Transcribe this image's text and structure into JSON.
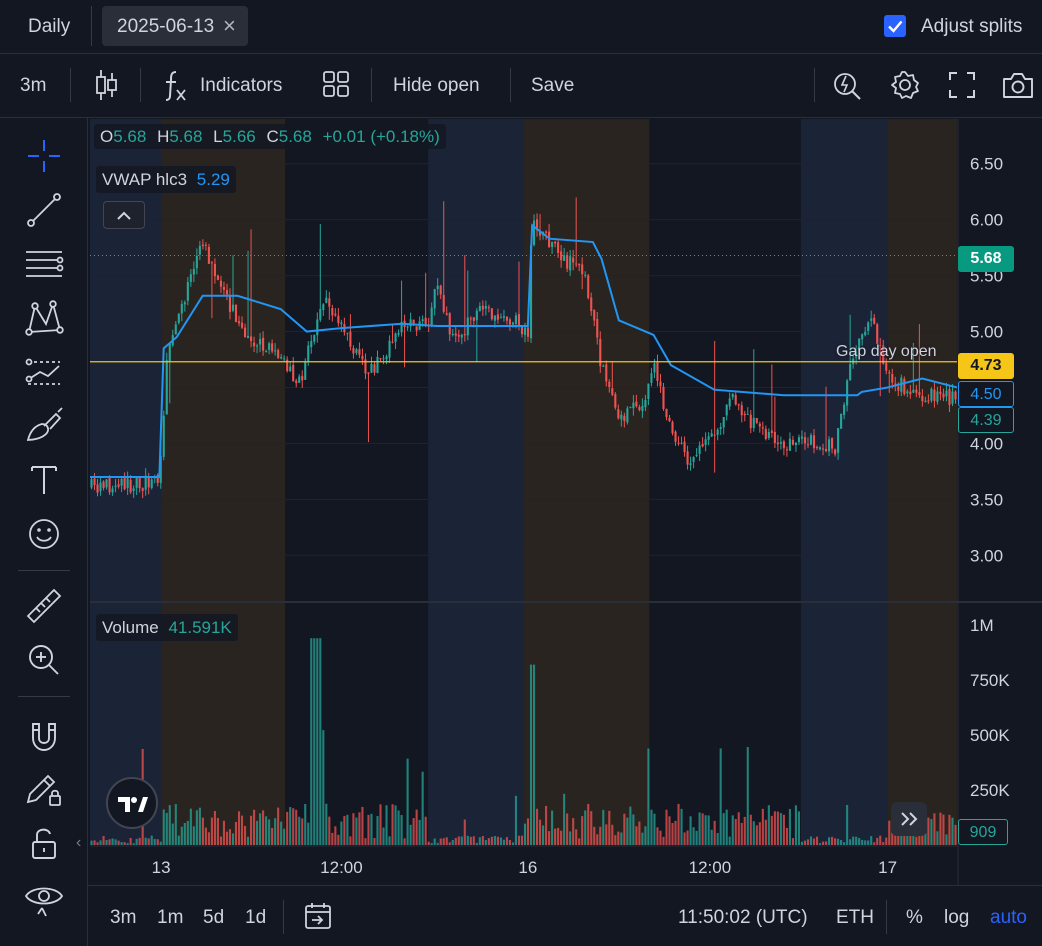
{
  "topbar": {
    "interval_label": "Daily",
    "date_value": "2025-06-13",
    "close_glyph": "×",
    "adjust_splits_label": "Adjust splits",
    "adjust_splits_checked": true
  },
  "toolbar": {
    "timeframe": "3m",
    "indicators_label": "Indicators",
    "hide_open_label": "Hide open",
    "save_label": "Save",
    "icons": [
      "candles-icon",
      "fx-icon",
      "layout-grid-icon",
      "alert-search-icon",
      "gear-icon",
      "fullscreen-icon",
      "camera-icon"
    ]
  },
  "left_tools": [
    "crosshair-icon",
    "trend-line-icon",
    "fib-lines-icon",
    "pattern-icon",
    "forecast-icon",
    "brush-icon",
    "text-icon",
    "emoji-icon",
    "ruler-icon",
    "zoom-in-icon",
    "magnet-icon",
    "pencil-lock-icon",
    "unlock-icon",
    "eye-icon"
  ],
  "legend": {
    "o_label": "O",
    "o_value": "5.68",
    "h_label": "H",
    "h_value": "5.68",
    "l_label": "L",
    "l_value": "5.66",
    "c_label": "C",
    "c_value": "5.68",
    "change": "+0.01 (+0.18%)",
    "vwap_label": "VWAP hlc3",
    "vwap_value": "5.29",
    "volume_label": "Volume",
    "volume_value": "41.591K"
  },
  "annotation": {
    "gap_label": "Gap day open"
  },
  "price_tags": {
    "last": "5.68",
    "gap": "4.73",
    "vwap": "4.50",
    "prev": "4.39",
    "volume": "909"
  },
  "colors": {
    "up": "#26a69a",
    "down": "#ef5350",
    "vwap": "#2196f3",
    "gap_line": "#f5c518",
    "premarket_bg": "#1b2336",
    "afterhours_bg": "#2a2420",
    "accent": "#2962ff"
  },
  "bottombar": {
    "tf_3m": "3m",
    "tf_1m": "1m",
    "tf_5d": "5d",
    "tf_1d": "1d",
    "time": "11:50:02 (UTC)",
    "session": "ETH",
    "pct": "%",
    "log": "log",
    "auto": "auto"
  },
  "chart_data": {
    "type": "candlestick",
    "title": "",
    "price_axis": {
      "ticks": [
        "6.50",
        "6.00",
        "5.50",
        "5.00",
        "4.50",
        "4.00",
        "3.50",
        "3.00"
      ],
      "ylim": [
        2.6,
        6.9
      ]
    },
    "volume_axis": {
      "ticks": [
        "1M",
        "750K",
        "500K",
        "250K"
      ],
      "ylim": [
        0,
        1050000
      ]
    },
    "x_ticks": [
      "13",
      "12:00",
      "16",
      "12:00",
      "17"
    ],
    "vwap_series": [
      {
        "t": 0.0,
        "v": 3.7
      },
      {
        "t": 0.08,
        "v": 3.7
      },
      {
        "t": 0.085,
        "v": 4.85
      },
      {
        "t": 0.1,
        "v": 4.95
      },
      {
        "t": 0.13,
        "v": 5.32
      },
      {
        "t": 0.17,
        "v": 5.32
      },
      {
        "t": 0.22,
        "v": 5.2
      },
      {
        "t": 0.25,
        "v": 5.0
      },
      {
        "t": 0.29,
        "v": 5.03
      },
      {
        "t": 0.36,
        "v": 5.07
      },
      {
        "t": 0.4,
        "v": 5.05
      },
      {
        "t": 0.505,
        "v": 5.05
      },
      {
        "t": 0.51,
        "v": 5.95
      },
      {
        "t": 0.53,
        "v": 5.83
      },
      {
        "t": 0.58,
        "v": 5.8
      },
      {
        "t": 0.59,
        "v": 5.65
      },
      {
        "t": 0.61,
        "v": 5.1
      },
      {
        "t": 0.65,
        "v": 4.97
      },
      {
        "t": 0.67,
        "v": 4.7
      },
      {
        "t": 0.72,
        "v": 4.48
      },
      {
        "t": 0.8,
        "v": 4.43
      },
      {
        "t": 0.885,
        "v": 4.43
      },
      {
        "t": 0.89,
        "v": 4.46
      },
      {
        "t": 0.92,
        "v": 4.5
      },
      {
        "t": 0.96,
        "v": 4.58
      },
      {
        "t": 1.0,
        "v": 4.5
      }
    ],
    "price_path": [
      {
        "t": 0.0,
        "v": 3.62
      },
      {
        "t": 0.04,
        "v": 3.63
      },
      {
        "t": 0.08,
        "v": 3.65
      },
      {
        "t": 0.09,
        "v": 4.9
      },
      {
        "t": 0.1,
        "v": 5.1
      },
      {
        "t": 0.13,
        "v": 5.8
      },
      {
        "t": 0.15,
        "v": 5.4
      },
      {
        "t": 0.18,
        "v": 4.95
      },
      {
        "t": 0.22,
        "v": 4.8
      },
      {
        "t": 0.24,
        "v": 4.5
      },
      {
        "t": 0.27,
        "v": 5.3
      },
      {
        "t": 0.3,
        "v": 4.9
      },
      {
        "t": 0.32,
        "v": 4.6
      },
      {
        "t": 0.36,
        "v": 5.05
      },
      {
        "t": 0.39,
        "v": 5.1
      },
      {
        "t": 0.4,
        "v": 5.45
      },
      {
        "t": 0.42,
        "v": 4.9
      },
      {
        "t": 0.45,
        "v": 5.2
      },
      {
        "t": 0.49,
        "v": 5.1
      },
      {
        "t": 0.505,
        "v": 4.95
      },
      {
        "t": 0.51,
        "v": 6.0
      },
      {
        "t": 0.54,
        "v": 5.7
      },
      {
        "t": 0.57,
        "v": 5.5
      },
      {
        "t": 0.58,
        "v": 5.1
      },
      {
        "t": 0.59,
        "v": 4.7
      },
      {
        "t": 0.61,
        "v": 4.2
      },
      {
        "t": 0.64,
        "v": 4.4
      },
      {
        "t": 0.65,
        "v": 4.75
      },
      {
        "t": 0.67,
        "v": 4.1
      },
      {
        "t": 0.69,
        "v": 3.85
      },
      {
        "t": 0.72,
        "v": 4.05
      },
      {
        "t": 0.74,
        "v": 4.4
      },
      {
        "t": 0.78,
        "v": 4.05
      },
      {
        "t": 0.81,
        "v": 4.0
      },
      {
        "t": 0.84,
        "v": 4.02
      },
      {
        "t": 0.86,
        "v": 3.95
      },
      {
        "t": 0.88,
        "v": 4.8
      },
      {
        "t": 0.9,
        "v": 5.15
      },
      {
        "t": 0.92,
        "v": 4.6
      },
      {
        "t": 0.95,
        "v": 4.45
      },
      {
        "t": 1.0,
        "v": 4.4
      }
    ],
    "gap_level": 4.73,
    "last_price": 5.68,
    "sessions": [
      {
        "kind": "pre",
        "from": 0.0,
        "to": 0.082
      },
      {
        "kind": "after",
        "from": 0.082,
        "to": 0.225
      },
      {
        "kind": "pre",
        "from": 0.39,
        "to": 0.5
      },
      {
        "kind": "after",
        "from": 0.5,
        "to": 0.645
      },
      {
        "kind": "pre",
        "from": 0.82,
        "to": 0.92
      },
      {
        "kind": "after",
        "from": 0.92,
        "to": 1.0
      }
    ]
  }
}
